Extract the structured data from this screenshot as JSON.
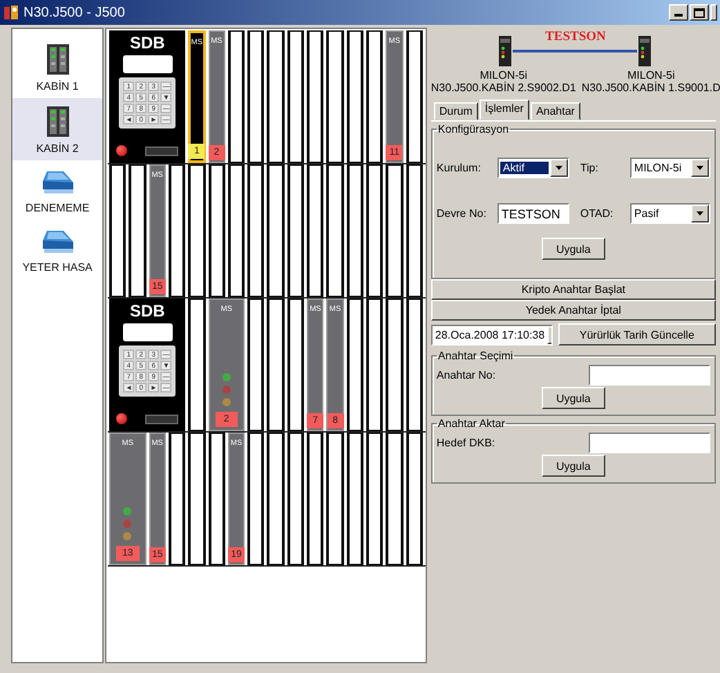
{
  "window": {
    "title": "N30.J500 - J500"
  },
  "sidebar": {
    "items": [
      {
        "label": "KABİN 1",
        "kind": "cabinet",
        "selected": false
      },
      {
        "label": "KABİN 2",
        "kind": "cabinet",
        "selected": true
      },
      {
        "label": "DENEMEME",
        "kind": "drive",
        "selected": false
      },
      {
        "label": "YETER HASA",
        "kind": "drive",
        "selected": false
      }
    ]
  },
  "rack": {
    "rows": [
      {
        "units": [
          {
            "kind": "sdb",
            "title": "SDB",
            "keys": [
              "1",
              "2",
              "3",
              "—",
              "4",
              "5",
              "6",
              "▼",
              "7",
              "8",
              "9",
              "—",
              "◄",
              "0",
              "►",
              "—"
            ]
          },
          {
            "kind": "module",
            "label": "MS",
            "number": "1",
            "selected": true,
            "color": "#f2ea50"
          },
          {
            "kind": "module",
            "label": "MS",
            "number": "2",
            "selected": false,
            "color": "#f25b5b"
          },
          {
            "kind": "empty"
          },
          {
            "kind": "empty"
          },
          {
            "kind": "empty"
          },
          {
            "kind": "empty"
          },
          {
            "kind": "empty"
          },
          {
            "kind": "empty"
          },
          {
            "kind": "empty"
          },
          {
            "kind": "empty"
          },
          {
            "kind": "module",
            "label": "MS",
            "number": "11",
            "selected": false,
            "color": "#f25b5b"
          },
          {
            "kind": "empty"
          }
        ]
      },
      {
        "units": [
          {
            "kind": "empty"
          },
          {
            "kind": "empty"
          },
          {
            "kind": "module",
            "label": "MS",
            "number": "15",
            "selected": false,
            "color": "#f25b5b"
          },
          {
            "kind": "empty"
          },
          {
            "kind": "empty"
          },
          {
            "kind": "empty"
          },
          {
            "kind": "empty"
          },
          {
            "kind": "empty"
          },
          {
            "kind": "empty"
          },
          {
            "kind": "empty"
          },
          {
            "kind": "empty"
          },
          {
            "kind": "empty"
          },
          {
            "kind": "empty"
          },
          {
            "kind": "empty"
          },
          {
            "kind": "empty"
          },
          {
            "kind": "empty"
          }
        ]
      },
      {
        "units": [
          {
            "kind": "sdb",
            "title": "SDB",
            "keys": [
              "1",
              "2",
              "3",
              "—",
              "4",
              "5",
              "6",
              "▼",
              "7",
              "8",
              "9",
              "—",
              "◄",
              "0",
              "►",
              "—"
            ]
          },
          {
            "kind": "empty"
          },
          {
            "kind": "wide-module",
            "label": "MS",
            "number": "2",
            "selected": false,
            "color": "#f25b5b"
          },
          {
            "kind": "empty"
          },
          {
            "kind": "empty"
          },
          {
            "kind": "empty"
          },
          {
            "kind": "module",
            "label": "MS",
            "number": "7",
            "selected": false,
            "color": "#f25b5b"
          },
          {
            "kind": "module",
            "label": "MS",
            "number": "8",
            "selected": false,
            "color": "#f25b5b"
          },
          {
            "kind": "empty"
          },
          {
            "kind": "empty"
          },
          {
            "kind": "empty"
          },
          {
            "kind": "empty"
          }
        ]
      },
      {
        "units": [
          {
            "kind": "wide-module",
            "label": "MS",
            "number": "13",
            "selected": false,
            "color": "#f25b5b"
          },
          {
            "kind": "module",
            "label": "MS",
            "number": "15",
            "selected": false,
            "color": "#f25b5b"
          },
          {
            "kind": "empty"
          },
          {
            "kind": "empty"
          },
          {
            "kind": "empty"
          },
          {
            "kind": "module",
            "label": "MS",
            "number": "19",
            "selected": false,
            "color": "#f25b5b"
          },
          {
            "kind": "empty"
          },
          {
            "kind": "empty"
          },
          {
            "kind": "empty"
          },
          {
            "kind": "empty"
          },
          {
            "kind": "empty"
          },
          {
            "kind": "empty"
          },
          {
            "kind": "empty"
          },
          {
            "kind": "empty"
          },
          {
            "kind": "empty"
          }
        ]
      }
    ]
  },
  "link": {
    "name": "TESTSON",
    "devices": [
      {
        "model": "MILON-5i",
        "path": "N30.J500.KABİN 2.S9002.D1"
      },
      {
        "model": "MILON-5i",
        "path": "N30.J500.KABİN 1.S9001.D"
      }
    ]
  },
  "tabs": [
    {
      "label": "Durum",
      "selected": false
    },
    {
      "label": "İşlemler",
      "selected": true
    },
    {
      "label": "Anahtar",
      "selected": false
    }
  ],
  "configuration": {
    "title": "Konfigürasyon",
    "fields": [
      {
        "label": "Kurulum:",
        "kind": "select",
        "value": "Aktif",
        "focused": true
      },
      {
        "label": "Tip:",
        "kind": "select",
        "value": "MILON-5i",
        "focused": false
      },
      {
        "label": "Devre No:",
        "kind": "text",
        "value": "TESTSON"
      },
      {
        "label": "OTAD:",
        "kind": "select",
        "value": "Pasif",
        "focused": false
      }
    ],
    "button": "Uygula"
  },
  "actions": [
    "Kripto Anahtar Başlat",
    "Yedek Anahtar İptal"
  ],
  "date": {
    "value": "28.Oca.2008 17:10:38",
    "button": "Yürürlük Tarih Güncelle"
  },
  "groups": [
    {
      "title": "Anahtar Seçimi",
      "label": "Anahtar No:",
      "button": "Uygula"
    },
    {
      "title": "Anahtar Aktar",
      "label": "Hedef DKB:",
      "button": "Uygula"
    }
  ]
}
